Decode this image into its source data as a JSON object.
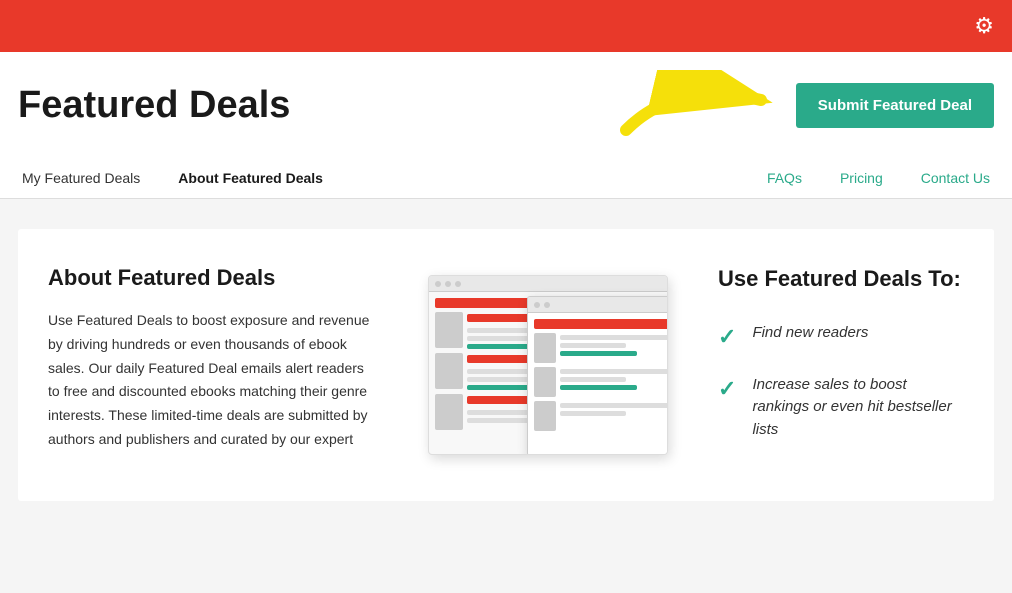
{
  "topBar": {
    "gearIcon": "⚙"
  },
  "header": {
    "title": "Featured Deals",
    "submitButton": "Submit Featured Deal"
  },
  "nav": {
    "leftItems": [
      {
        "label": "My Featured Deals",
        "active": false
      },
      {
        "label": "About Featured Deals",
        "active": true
      }
    ],
    "rightItems": [
      {
        "label": "FAQs",
        "teal": true
      },
      {
        "label": "Pricing",
        "teal": true
      },
      {
        "label": "Contact Us",
        "teal": true
      }
    ]
  },
  "aboutSection": {
    "title": "About Featured Deals",
    "body": "Use Featured Deals to boost exposure and revenue by driving hundreds or even thousands of ebook sales. Our daily Featured Deal emails alert readers to free and discounted ebooks matching their genre interests. These limited-time deals are submitted by authors and publishers and curated by our expert"
  },
  "useSection": {
    "title": "Use Featured Deals To:",
    "items": [
      {
        "text": "Find new readers"
      },
      {
        "text": "Increase sales to boost rankings or even hit bestseller lists"
      }
    ]
  }
}
